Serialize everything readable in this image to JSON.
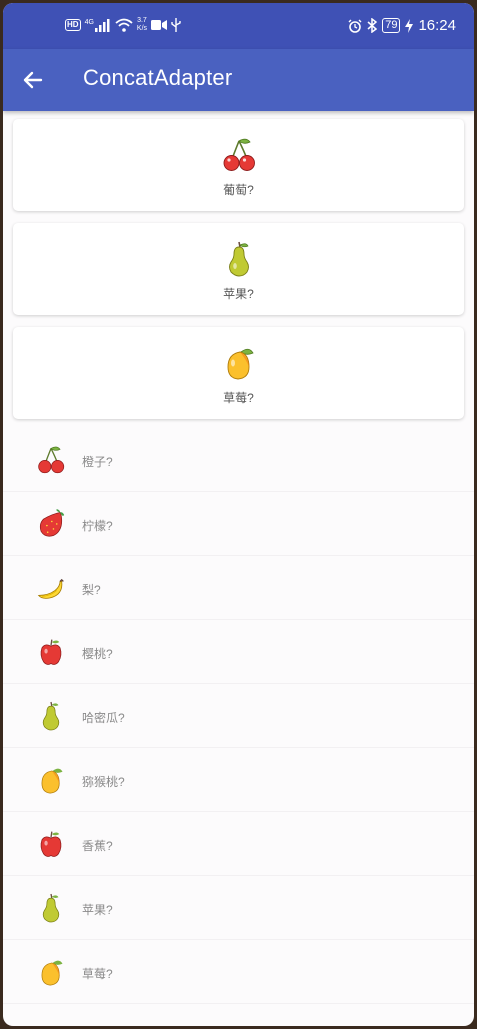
{
  "status_bar": {
    "hd": "HD",
    "signal_type": "4G",
    "net_speed_value": "3.7",
    "net_speed_unit": "K/s",
    "battery": "79",
    "time": "16:24"
  },
  "app_bar": {
    "title": "ConcatAdapter"
  },
  "header_cards": [
    {
      "label": "葡萄?",
      "icon": "cherry-icon"
    },
    {
      "label": "苹果?",
      "icon": "pear-icon"
    },
    {
      "label": "草莓?",
      "icon": "mango-icon"
    }
  ],
  "list_items": [
    {
      "label": "橙子?",
      "icon": "cherry-icon"
    },
    {
      "label": "柠檬?",
      "icon": "strawberry-icon"
    },
    {
      "label": "梨?",
      "icon": "banana-icon"
    },
    {
      "label": "樱桃?",
      "icon": "apple-icon"
    },
    {
      "label": "哈密瓜?",
      "icon": "pear-icon"
    },
    {
      "label": "猕猴桃?",
      "icon": "mango-icon"
    },
    {
      "label": "香蕉?",
      "icon": "apple-icon"
    },
    {
      "label": "苹果?",
      "icon": "pear-icon"
    },
    {
      "label": "草莓?",
      "icon": "mango-icon"
    }
  ],
  "colors": {
    "status_bar": "#3f51b5",
    "app_bar": "#4a61c0"
  }
}
